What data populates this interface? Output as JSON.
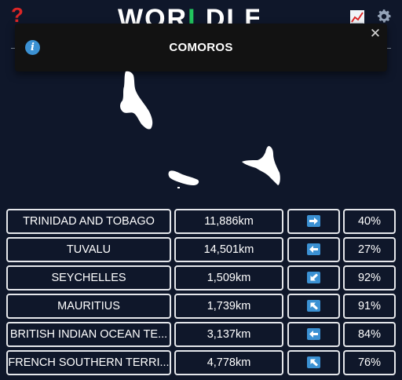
{
  "header": {
    "help_icon": "question-mark-icon",
    "logo_left": "WOR",
    "logo_mid": "L",
    "logo_right": "DLE",
    "stats_icon": "chart-icon",
    "settings_icon": "gear-icon",
    "logo_accent_color": "#22c55e",
    "help_color": "#dc2626"
  },
  "toast": {
    "icon": "info-icon",
    "text": "COMOROS",
    "close_icon": "close-icon"
  },
  "guesses": [
    {
      "country": "TRINIDAD AND TOBAGO",
      "distance": "11,886km",
      "direction": "E",
      "percent": "40%"
    },
    {
      "country": "TUVALU",
      "distance": "14,501km",
      "direction": "W",
      "percent": "27%"
    },
    {
      "country": "SEYCHELLES",
      "distance": "1,509km",
      "direction": "SW",
      "percent": "92%"
    },
    {
      "country": "MAURITIUS",
      "distance": "1,739km",
      "direction": "NW",
      "percent": "91%"
    },
    {
      "country": "BRITISH INDIAN OCEAN TE...",
      "distance": "3,137km",
      "direction": "W",
      "percent": "84%"
    },
    {
      "country": "FRENCH SOUTHERN TERRI...",
      "distance": "4,778km",
      "direction": "NW",
      "percent": "76%"
    }
  ],
  "colors": {
    "background": "#0f172a",
    "arrow_tile": "#3b91d3",
    "toast_background": "#121212"
  }
}
